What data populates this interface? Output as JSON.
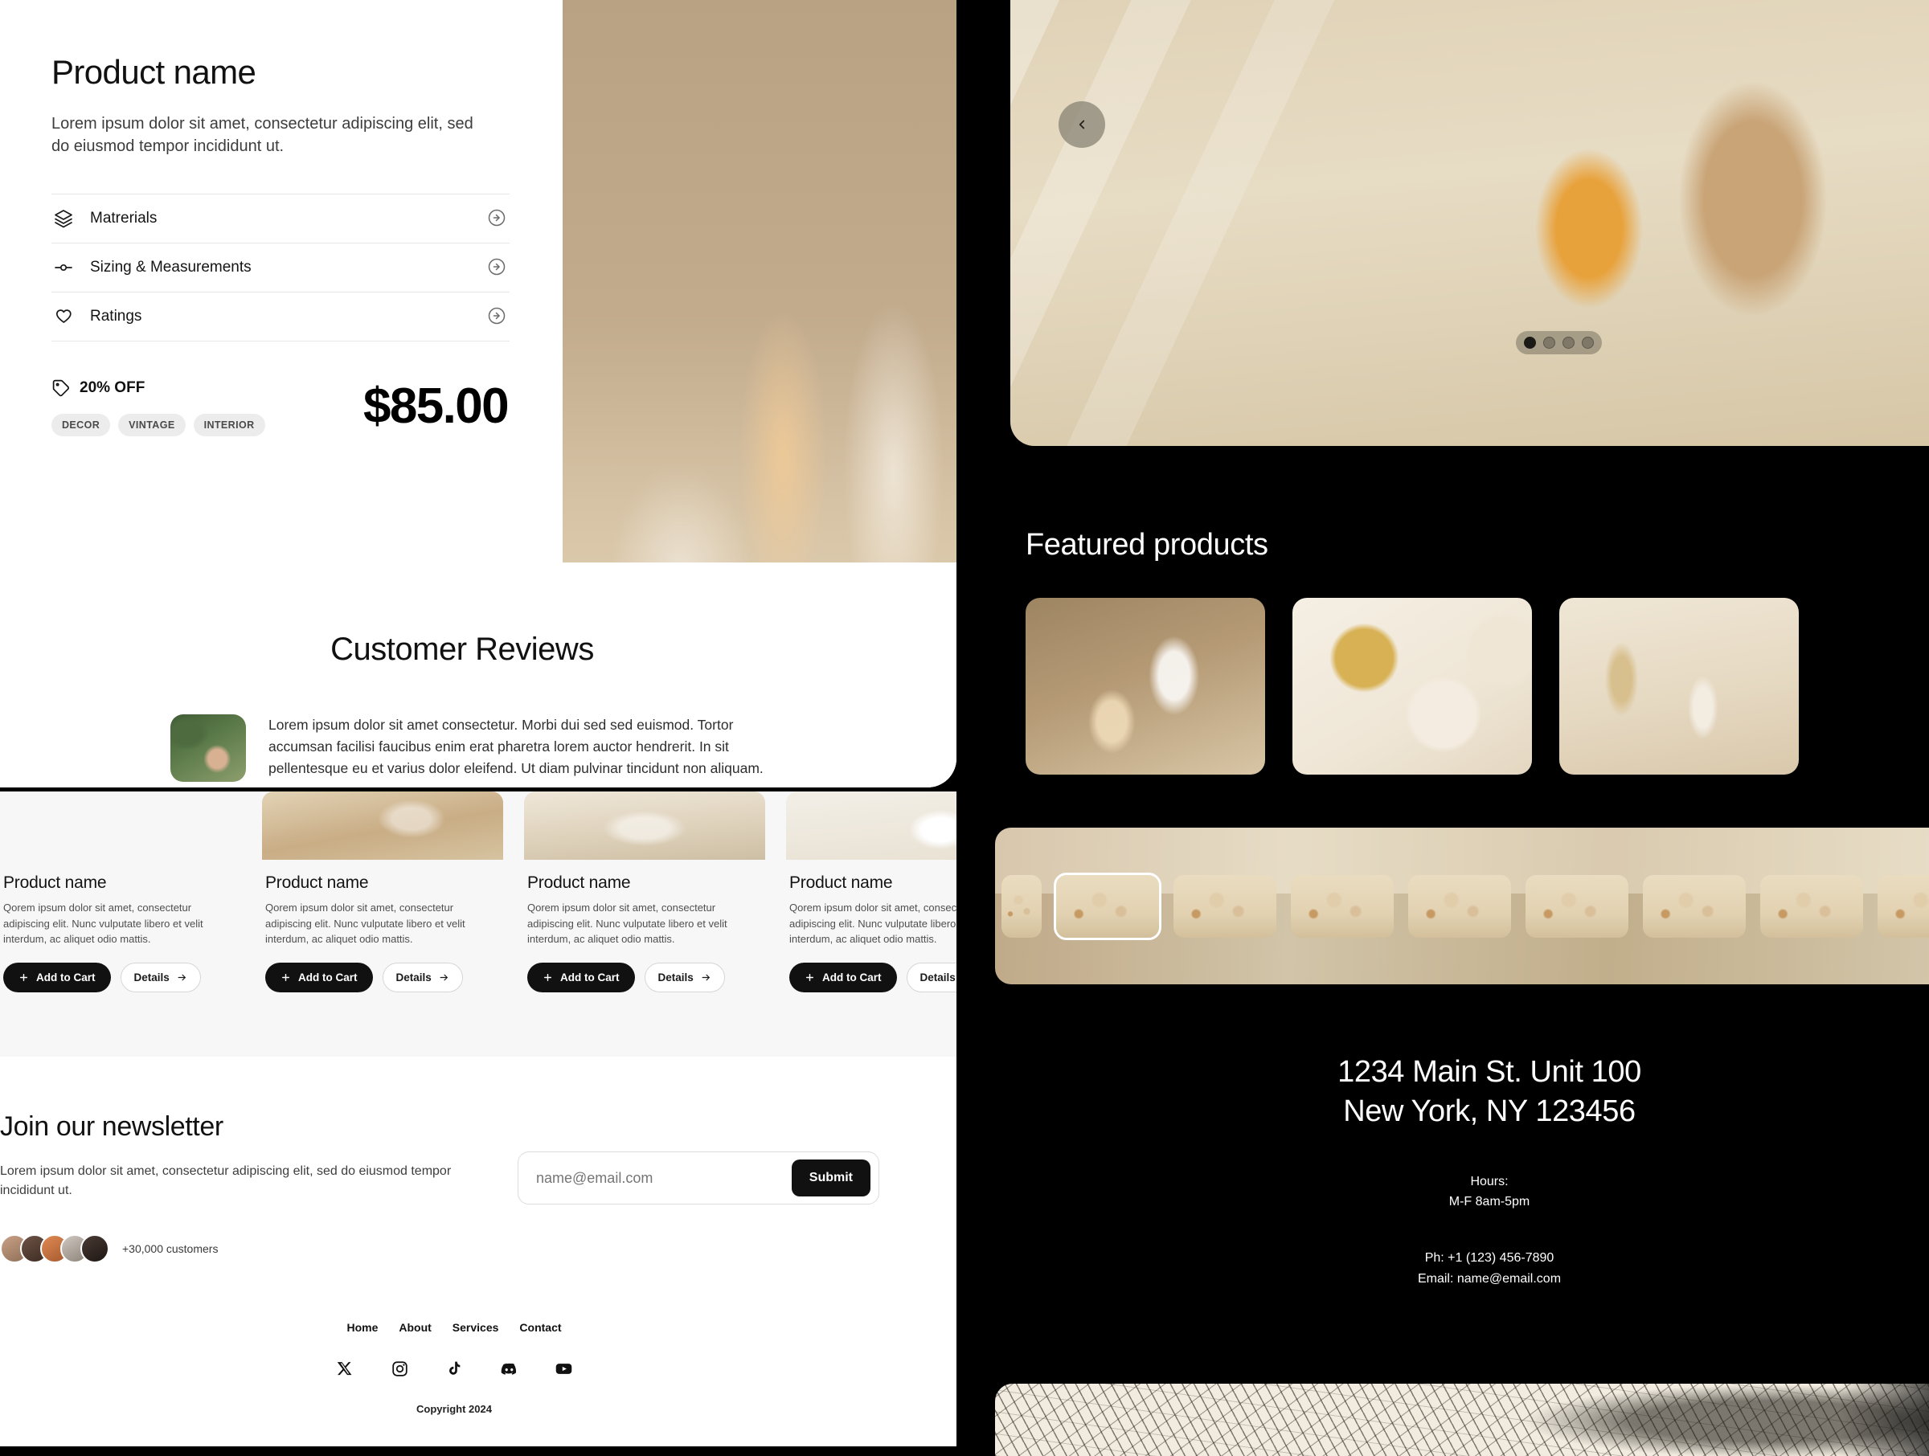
{
  "product_detail": {
    "title": "Product name",
    "description": "Lorem ipsum dolor sit amet, consectetur adipiscing elit, sed do eiusmod tempor incididunt ut.",
    "specs": [
      {
        "label": "Matrerials",
        "icon": "layers-icon"
      },
      {
        "label": "Sizing & Measurements",
        "icon": "ruler-slider-icon"
      },
      {
        "label": "Ratings",
        "icon": "heart-icon"
      }
    ],
    "discount_label": "20% OFF",
    "tags": [
      "DECOR",
      "VINTAGE",
      "INTERIOR"
    ],
    "price": "$85.00"
  },
  "reviews": {
    "title": "Customer Reviews",
    "items": [
      {
        "text": "Lorem ipsum dolor sit amet consectetur. Morbi dui sed sed euismod. Tortor accumsan facilisi faucibus enim erat pharetra lorem auctor hendrerit. In sit pellentesque eu et varius dolor eleifend. Ut diam pulvinar tincidunt non aliquam."
      }
    ]
  },
  "hero": {
    "prev_label": "‹",
    "dots": [
      true,
      false,
      false,
      false
    ]
  },
  "featured": {
    "title": "Featured products",
    "cards": [
      "ph-tube",
      "ph-compact",
      "ph-vase",
      "ph-frame"
    ]
  },
  "product_grid": {
    "cards": [
      {
        "title": "Product name",
        "desc": "Qorem ipsum dolor sit amet, consectetur adipiscing elit. Nunc vulputate libero et velit interdum, ac aliquet odio mattis.",
        "add_label": "Add to Cart",
        "details_label": "Details"
      },
      {
        "title": "Product name",
        "desc": "Qorem ipsum dolor sit amet, consectetur adipiscing elit. Nunc vulputate libero et velit interdum, ac aliquet odio mattis.",
        "add_label": "Add to Cart",
        "details_label": "Details"
      },
      {
        "title": "Product name",
        "desc": "Qorem ipsum dolor sit amet, consectetur adipiscing elit. Nunc vulputate libero et velit interdum, ac aliquet odio mattis.",
        "add_label": "Add to Cart",
        "details_label": "Details"
      },
      {
        "title": "Product name",
        "desc": "Qorem ipsum dolor sit amet, consectetur adipiscing elit. Nunc vulputate libero et velit interdum, ac aliquet odio mattis.",
        "add_label": "Add to Cart",
        "details_label": "Details"
      }
    ]
  },
  "newsletter": {
    "title": "Join our newsletter",
    "description": "Lorem ipsum dolor sit amet, consectetur adipiscing elit, sed do eiusmod tempor incididunt ut.",
    "customers_count": "+30,000 customers",
    "email_placeholder": "name@email.com",
    "submit_label": "Submit"
  },
  "footer": {
    "nav": [
      "Home",
      "About",
      "Services",
      "Contact"
    ],
    "social": [
      "x-icon",
      "instagram-icon",
      "tiktok-icon",
      "discord-icon",
      "youtube-icon"
    ],
    "copyright": "Copyright 2024"
  },
  "contact": {
    "address_line1": "1234 Main St. Unit 100",
    "address_line2": "New York, NY 123456",
    "hours_label": "Hours:",
    "hours_value": "M-F 8am-5pm",
    "phone": "Ph: +1 (123) 456-7890",
    "email": "Email: name@email.com"
  },
  "thumbs": {
    "count": 11,
    "selected_index": 0
  }
}
